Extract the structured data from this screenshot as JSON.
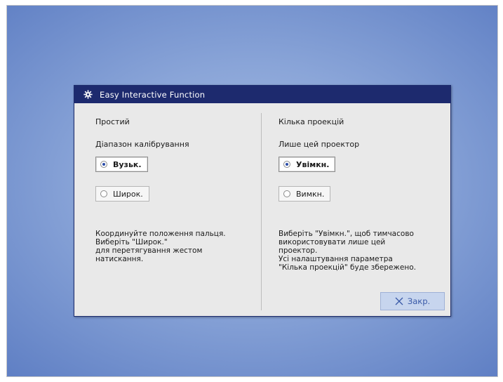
{
  "dialog": {
    "title": "Easy Interactive Function",
    "icon": "gear-icon"
  },
  "left": {
    "heading": "Простий",
    "sublabel": "Діапазон калібрування",
    "options": [
      {
        "label": "Вузьк.",
        "selected": true
      },
      {
        "label": "Широк.",
        "selected": false
      }
    ],
    "description": "Координуйте положення пальця.\nВиберіть \"Широк.\"\nдля перетягування жестом\nнатискання."
  },
  "right": {
    "heading": "Кілька проекцій",
    "sublabel": "Лише цей проектор",
    "options": [
      {
        "label": "Увімкн.",
        "selected": true
      },
      {
        "label": "Вимкн.",
        "selected": false
      }
    ],
    "description": "Виберіть \"Увімкн.\", щоб тимчасово\nвикористовувати лише цей\nпроектор.\nУсі налаштування параметра\n\"Кілька проекцій\" буде збережено."
  },
  "close_button": {
    "label": "Закр.",
    "icon": "close-icon"
  },
  "colors": {
    "titlebar": "#1d2a6e",
    "dialog_bg": "#e9e9e9",
    "close_button_bg": "#c7d5ee",
    "accent_text": "#3a5aa8"
  }
}
